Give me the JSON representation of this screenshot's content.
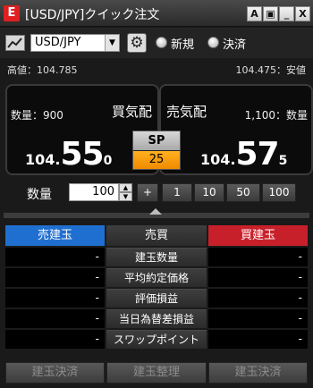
{
  "window": {
    "logo_glyph": "E",
    "title": "[USD/JPY]クイック注文",
    "buttons": [
      "A",
      "▣",
      "_",
      "X"
    ]
  },
  "toolbar": {
    "currency_pair": "USD/JPY",
    "dropdown_arrow": "▼",
    "gear_glyph": "⚙",
    "radio_new_label": "新規",
    "radio_settle_label": "決済"
  },
  "stats": {
    "high_label": "高値：104.785",
    "low_label": "104.475：安値"
  },
  "sell_panel": {
    "qty_label": "数量：900",
    "side_label": "買気配",
    "price_prefix": "104.",
    "price_main": "55",
    "price_suffix": "0"
  },
  "buy_panel": {
    "side_label": "売気配",
    "qty_label": "1,100：数量",
    "price_prefix": "104.",
    "price_main": "57",
    "price_suffix": "5"
  },
  "spread": {
    "label": "SP",
    "value": "25"
  },
  "quantity": {
    "label": "数量",
    "value": "100",
    "spin_up": "▲",
    "spin_down": "▼",
    "increment_buttons": [
      "+",
      "1",
      "10",
      "50",
      "100"
    ]
  },
  "positions_table": {
    "headers": [
      "売建玉",
      "売買",
      "買建玉"
    ],
    "rows": [
      {
        "label": "建玉数量",
        "sell": "-",
        "buy": "-"
      },
      {
        "label": "平均約定価格",
        "sell": "-",
        "buy": "-"
      },
      {
        "label": "評価損益",
        "sell": "-",
        "buy": "-"
      },
      {
        "label": "当日為替差損益",
        "sell": "-",
        "buy": "-"
      },
      {
        "label": "スワップポイント",
        "sell": "-",
        "buy": "-"
      }
    ]
  },
  "bottom_buttons": [
    "建玉決済",
    "建玉整理",
    "建玉決済"
  ],
  "colors": {
    "sell_header": "#1f6fd0",
    "buy_header": "#c8202a",
    "spread_value_bg": "#f39a00",
    "logo": "#e02020"
  }
}
